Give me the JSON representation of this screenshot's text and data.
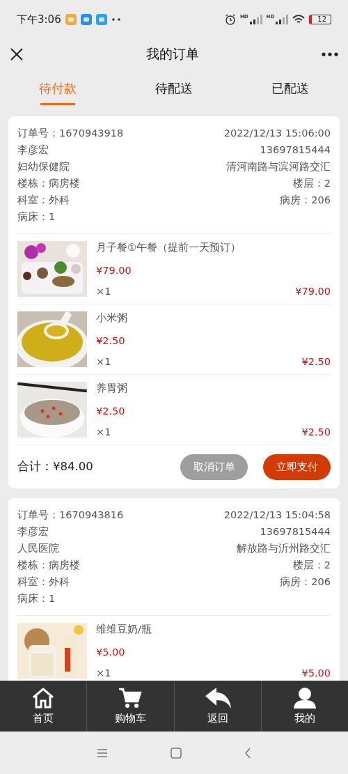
{
  "status_bar": {
    "time": "下午3:06",
    "signal_labels": [
      "HD",
      "HD"
    ],
    "battery": "12"
  },
  "header": {
    "title": "我的订单"
  },
  "tabs": [
    {
      "label": "待付款",
      "selected": true
    },
    {
      "label": "待配送",
      "selected": false
    },
    {
      "label": "已配送",
      "selected": false
    }
  ],
  "orders": [
    {
      "order_no": "订单号：1670943918",
      "time": "2022/12/13 15:06:00",
      "name": "李彦宏",
      "phone": "13697815444",
      "hospital": "妇幼保健院",
      "address": "清河南路与滨河路交汇",
      "building": "楼栋：病房楼",
      "floor": "楼层：2",
      "department": "科室：外科",
      "room": "病房：206",
      "bed": "病床：1",
      "items": [
        {
          "name": "月子餐①午餐（提前一天预订）",
          "price": "¥79.00",
          "qty": "×1",
          "subtotal": "¥79.00"
        },
        {
          "name": "小米粥",
          "price": "¥2.50",
          "qty": "×1",
          "subtotal": "¥2.50"
        },
        {
          "name": "养胃粥",
          "price": "¥2.50",
          "qty": "×1",
          "subtotal": "¥2.50"
        }
      ],
      "total": "合计：¥84.00",
      "actions": [
        {
          "label": "取消订单",
          "kind": "secondary"
        },
        {
          "label": "立即支付",
          "kind": "primary"
        }
      ]
    },
    {
      "order_no": "订单号：1670943816",
      "time": "2022/12/13 15:04:58",
      "name": "李彦宏",
      "phone": "13697815444",
      "hospital": "人民医院",
      "address": "解放路与沂州路交汇",
      "building": "楼栋：病房楼",
      "floor": "楼层：2",
      "department": "科室：外科",
      "room": "病房：206",
      "bed": "病床：1",
      "items": [
        {
          "name": "维维豆奶/瓶",
          "price": "¥5.00",
          "qty": "×1",
          "subtotal": "¥5.00"
        }
      ]
    }
  ],
  "bottom_nav": [
    {
      "label": "首页"
    },
    {
      "label": "购物车"
    },
    {
      "label": "返回"
    },
    {
      "label": "我的"
    }
  ]
}
